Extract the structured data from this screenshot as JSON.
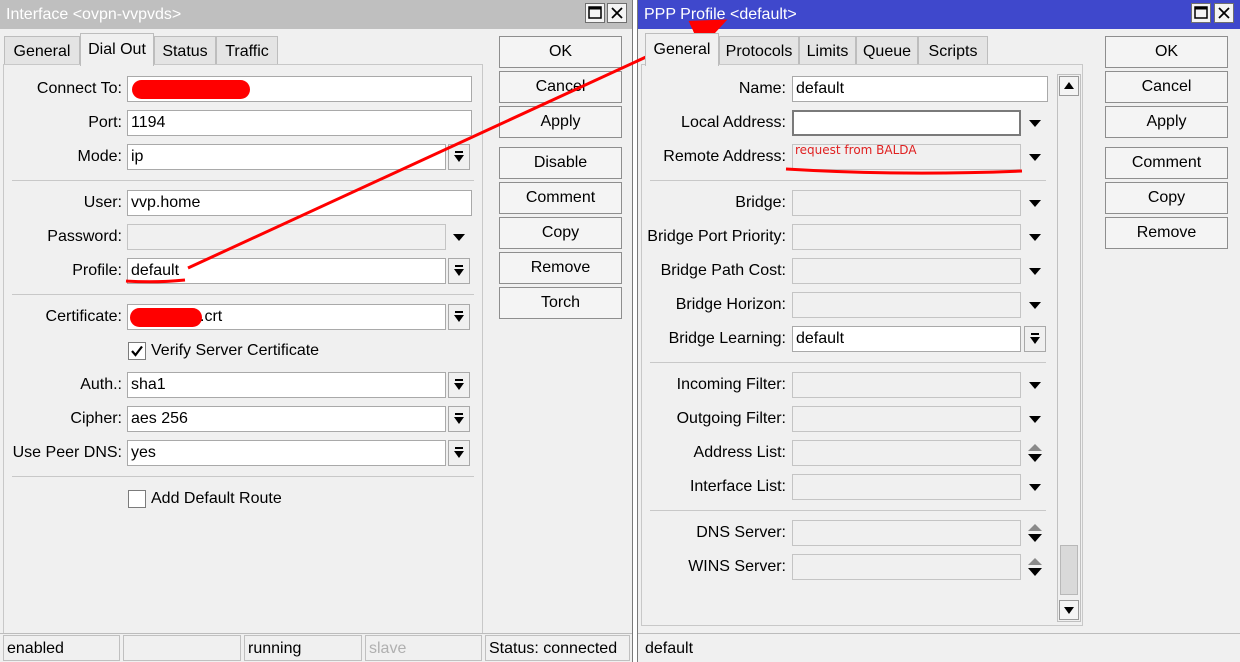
{
  "interface_window": {
    "title": "Interface <ovpn-vvpvds>",
    "tabs": [
      "General",
      "Dial Out",
      "Status",
      "Traffic"
    ],
    "active_tab": "Dial Out",
    "fields": {
      "connect_to": {
        "label": "Connect To:",
        "value": ""
      },
      "port": {
        "label": "Port:",
        "value": "1194"
      },
      "mode": {
        "label": "Mode:",
        "value": "ip"
      },
      "user": {
        "label": "User:",
        "value": "vvp.home"
      },
      "password": {
        "label": "Password:",
        "value": ""
      },
      "profile": {
        "label": "Profile:",
        "value": "default"
      },
      "certificate": {
        "label": "Certificate:",
        "value": ".crt"
      },
      "auth": {
        "label": "Auth.:",
        "value": "sha1"
      },
      "cipher": {
        "label": "Cipher:",
        "value": "aes 256"
      },
      "use_peer_dns": {
        "label": "Use Peer DNS:",
        "value": "yes"
      }
    },
    "verify_server_certificate": {
      "label": "Verify Server Certificate",
      "checked": true
    },
    "add_default_route": {
      "label": "Add Default Route",
      "checked": false
    },
    "buttons": {
      "ok": "OK",
      "cancel": "Cancel",
      "apply": "Apply",
      "disable": "Disable",
      "comment": "Comment",
      "copy": "Copy",
      "remove": "Remove",
      "torch": "Torch"
    },
    "status_bar": [
      "enabled",
      "",
      "running",
      "slave",
      "Status: connected"
    ]
  },
  "ppp_window": {
    "title": "PPP Profile <default>",
    "tabs": [
      "General",
      "Protocols",
      "Limits",
      "Queue",
      "Scripts"
    ],
    "active_tab": "General",
    "fields": {
      "name": {
        "label": "Name:",
        "value": "default"
      },
      "local_address": {
        "label": "Local Address:",
        "value": ""
      },
      "remote_address": {
        "label": "Remote Address:",
        "value": ""
      },
      "bridge": {
        "label": "Bridge:",
        "value": ""
      },
      "bridge_port_priority": {
        "label": "Bridge Port Priority:",
        "value": ""
      },
      "bridge_path_cost": {
        "label": "Bridge Path Cost:",
        "value": ""
      },
      "bridge_horizon": {
        "label": "Bridge Horizon:",
        "value": ""
      },
      "bridge_learning": {
        "label": "Bridge Learning:",
        "value": "default"
      },
      "incoming_filter": {
        "label": "Incoming Filter:",
        "value": ""
      },
      "outgoing_filter": {
        "label": "Outgoing Filter:",
        "value": ""
      },
      "address_list": {
        "label": "Address List:",
        "value": ""
      },
      "interface_list": {
        "label": "Interface List:",
        "value": ""
      },
      "dns_server": {
        "label": "DNS Server:",
        "value": ""
      },
      "wins_server": {
        "label": "WINS Server:",
        "value": ""
      }
    },
    "annotation": "request from BALDA",
    "buttons": {
      "ok": "OK",
      "cancel": "Cancel",
      "apply": "Apply",
      "comment": "Comment",
      "copy": "Copy",
      "remove": "Remove"
    },
    "status_bar": "default"
  },
  "colors": {
    "annotation_red": "#ff0000",
    "ppp_title_blue": "#3f48cc",
    "iface_title_gray": "#bfbfbf"
  }
}
